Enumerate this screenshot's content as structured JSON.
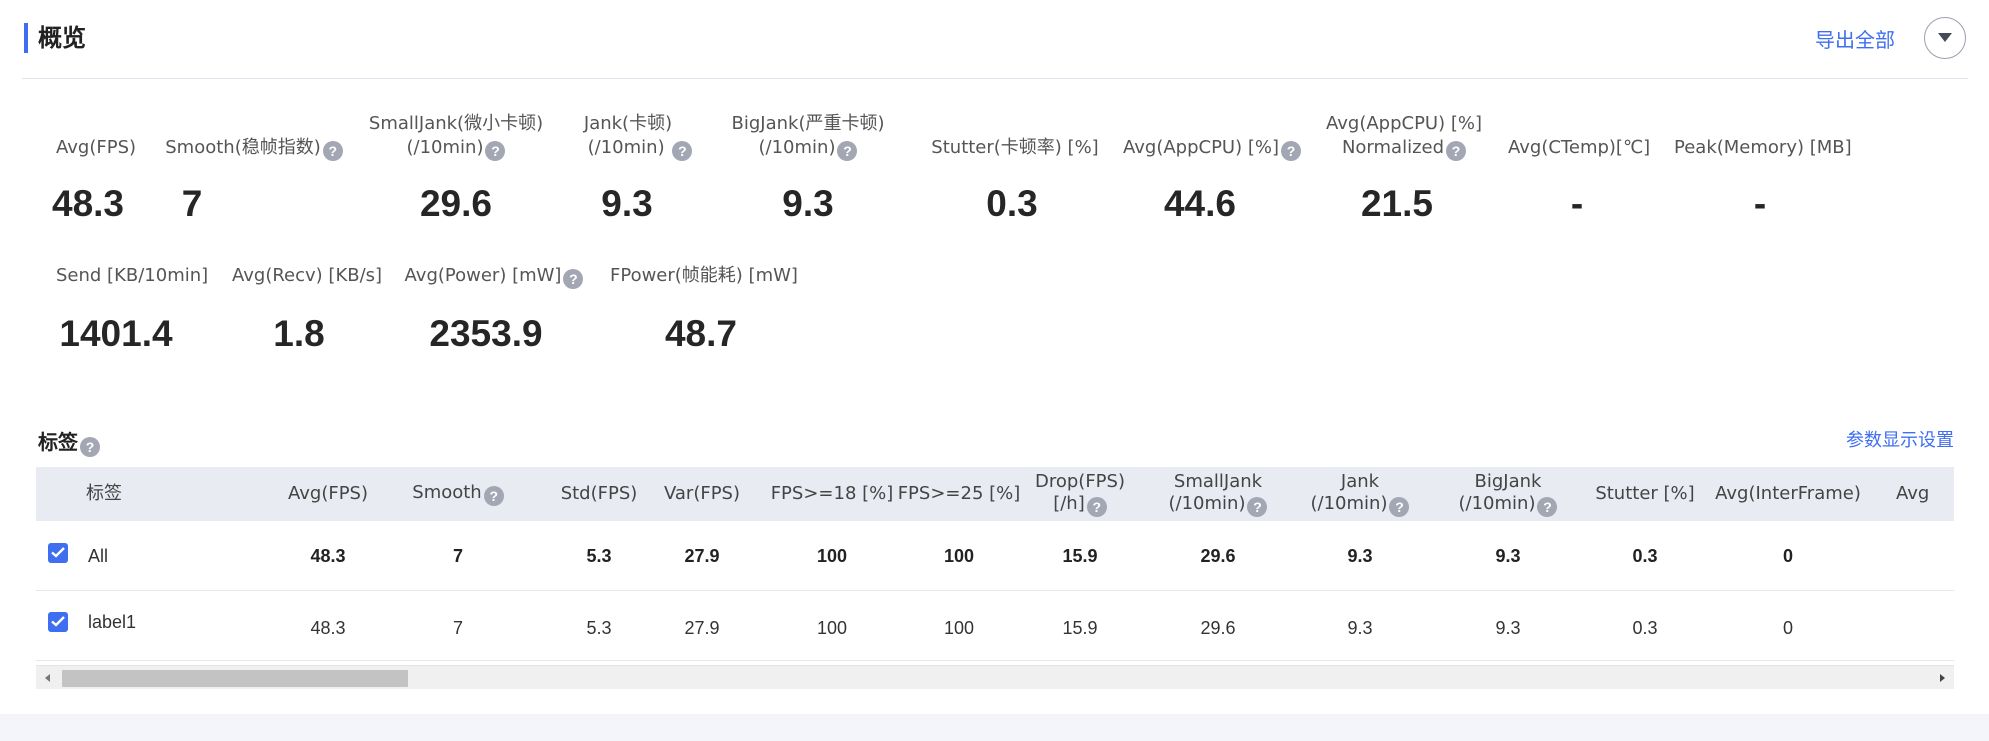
{
  "header": {
    "title": "概览",
    "export_label": "导出全部"
  },
  "overview": {
    "row1": [
      {
        "label": "Avg(FPS)",
        "value": "48.3"
      },
      {
        "label": "Smooth(稳帧指数)",
        "value": "7"
      },
      {
        "label": "SmallJank(微小卡顿)",
        "label2": "(/10min)",
        "value": "29.6"
      },
      {
        "label": "Jank(卡顿)",
        "label2": "(/10min)",
        "value": "9.3"
      },
      {
        "label": "BigJank(严重卡顿)",
        "label2": "(/10min)",
        "value": "9.3"
      },
      {
        "label": "Stutter(卡顿率) [%]",
        "value": "0.3"
      },
      {
        "label": "Avg(AppCPU) [%]",
        "value": "44.6"
      },
      {
        "label": "Avg(AppCPU) [%]",
        "label2": "Normalized",
        "value": "21.5"
      },
      {
        "label": "Avg(CTemp)[℃]",
        "value": "-"
      },
      {
        "label": "Peak(Memory) [MB]",
        "value": "-"
      }
    ],
    "row2": [
      {
        "label": "Send [KB/10min]",
        "value": "1401.4"
      },
      {
        "label": "Avg(Recv) [KB/s]",
        "value": "1.8"
      },
      {
        "label": "Avg(Power) [mW]",
        "value": "2353.9"
      },
      {
        "label": "FPower(帧能耗) [mW]",
        "value": "48.7"
      }
    ]
  },
  "tags": {
    "title": "标签",
    "settings_label": "参数显示设置",
    "columns": [
      {
        "line1": "标签",
        "line2": ""
      },
      {
        "line1": "Avg(FPS)",
        "line2": ""
      },
      {
        "line1": "Smooth",
        "line2": ""
      },
      {
        "line1": "Std(FPS)",
        "line2": ""
      },
      {
        "line1": "Var(FPS)",
        "line2": ""
      },
      {
        "line1": "FPS>=18 [%]",
        "line2": ""
      },
      {
        "line1": "FPS>=25 [%]",
        "line2": ""
      },
      {
        "line1": "Drop(FPS)",
        "line2": "[/h]"
      },
      {
        "line1": "SmallJank",
        "line2": "(/10min)"
      },
      {
        "line1": "Jank",
        "line2": "(/10min)"
      },
      {
        "line1": "BigJank",
        "line2": "(/10min)"
      },
      {
        "line1": "Stutter [%]",
        "line2": ""
      },
      {
        "line1": "Avg(InterFrame)",
        "line2": ""
      },
      {
        "line1": "Avg",
        "line2": ""
      }
    ],
    "rows": [
      {
        "label": "All",
        "checked": true,
        "values": [
          "48.3",
          "7",
          "5.3",
          "27.9",
          "100",
          "100",
          "15.9",
          "29.6",
          "9.3",
          "9.3",
          "0.3",
          "0"
        ]
      },
      {
        "label": "label1",
        "checked": true,
        "values": [
          "48.3",
          "7",
          "5.3",
          "27.9",
          "100",
          "100",
          "15.9",
          "29.6",
          "9.3",
          "9.3",
          "0.3",
          "0"
        ]
      }
    ]
  },
  "colors": {
    "accent": "#3f6ff0",
    "header_bg": "#e9ebf3"
  }
}
